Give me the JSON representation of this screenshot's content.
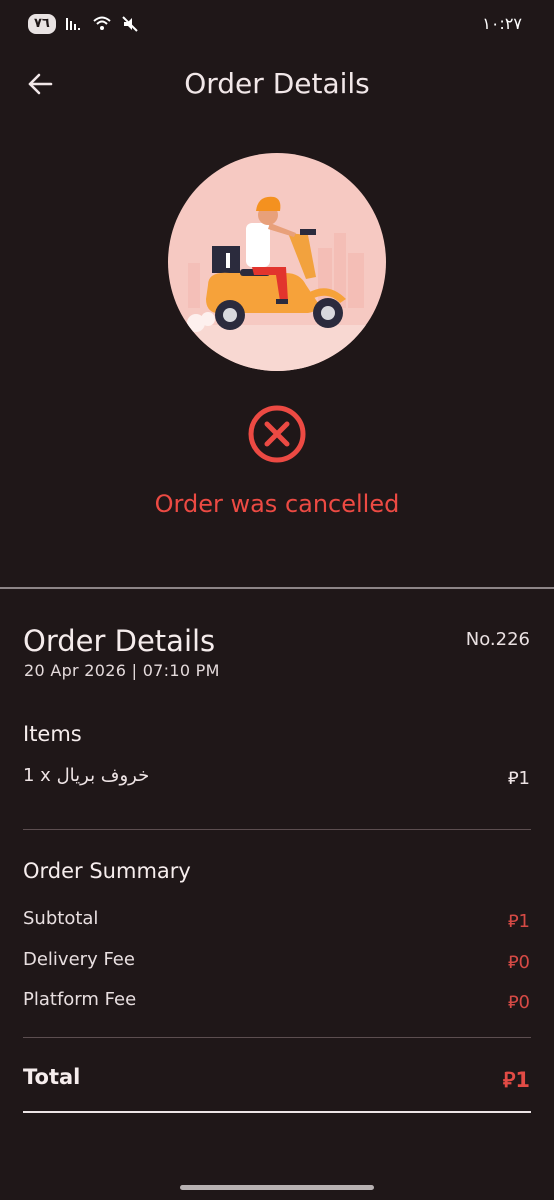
{
  "status_bar": {
    "battery": "٧٦",
    "time": "١٠:٢٧"
  },
  "app_bar": {
    "title": "Order Details"
  },
  "status": {
    "message": "Order was cancelled"
  },
  "order": {
    "title": "Order Details",
    "number": "No.226",
    "date": "20 Apr 2026 | 07:10 PM"
  },
  "items": {
    "title": "Items",
    "list": [
      {
        "text": "1 x خروف بريال",
        "price": "⃁1"
      }
    ]
  },
  "summary": {
    "title": "Order Summary",
    "rows": [
      {
        "label": "Subtotal",
        "value": "⃁1"
      },
      {
        "label": "Delivery Fee",
        "value": "⃁0"
      },
      {
        "label": "Platform Fee",
        "value": "⃁0"
      }
    ],
    "total_label": "Total",
    "total_value": "⃁1"
  },
  "colors": {
    "background": "#1f1718",
    "accent_red": "#ec4a43",
    "hero_bg": "#f6c9c2"
  }
}
